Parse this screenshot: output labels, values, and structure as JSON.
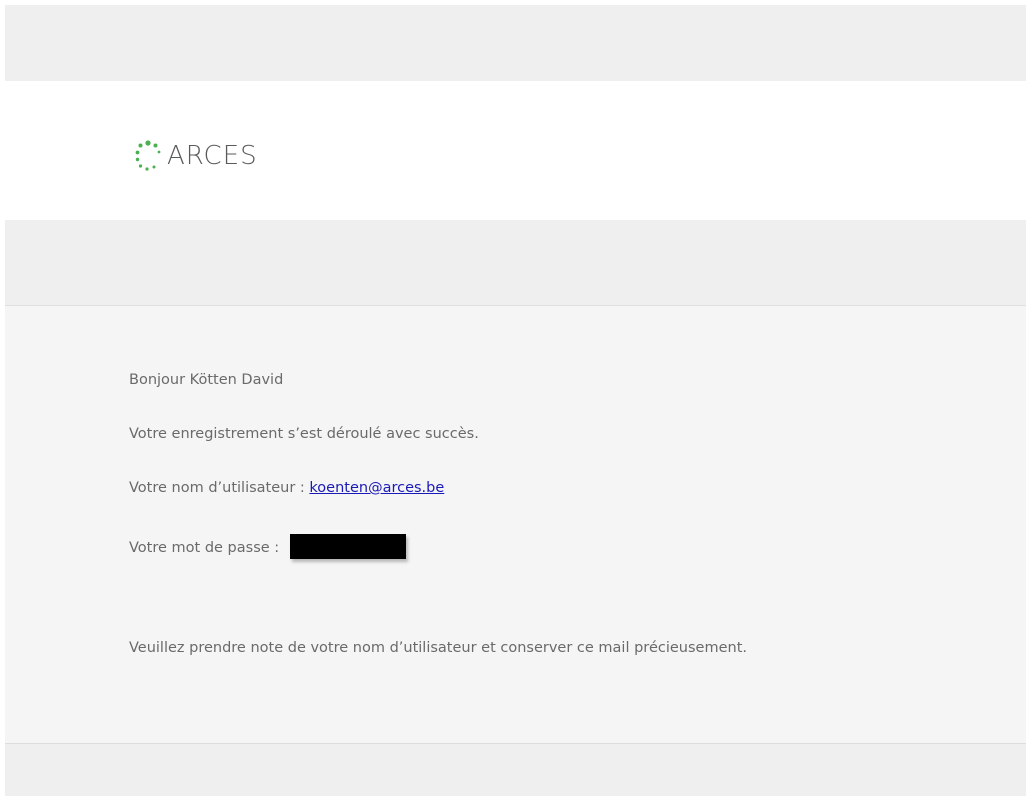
{
  "logo": {
    "text": "ARCES",
    "accent_color": "#4caf50",
    "icon": "dotted-circle-logo-icon"
  },
  "message": {
    "greeting": "Bonjour Kötten David",
    "success_text": "Votre enregistrement s’est déroulé avec succès.",
    "username_label": "Votre nom d’utilisateur : ",
    "username_value": "koenten@arces.be",
    "password_label": "Votre mot de passe : ",
    "note": "Veuillez prendre note de votre nom d’utilisateur et conserver ce mail précieusement."
  },
  "colors": {
    "background_band": "#efefef",
    "content_background": "#f5f5f5",
    "text": "#6a6a6a",
    "link": "#1a1ab8"
  }
}
